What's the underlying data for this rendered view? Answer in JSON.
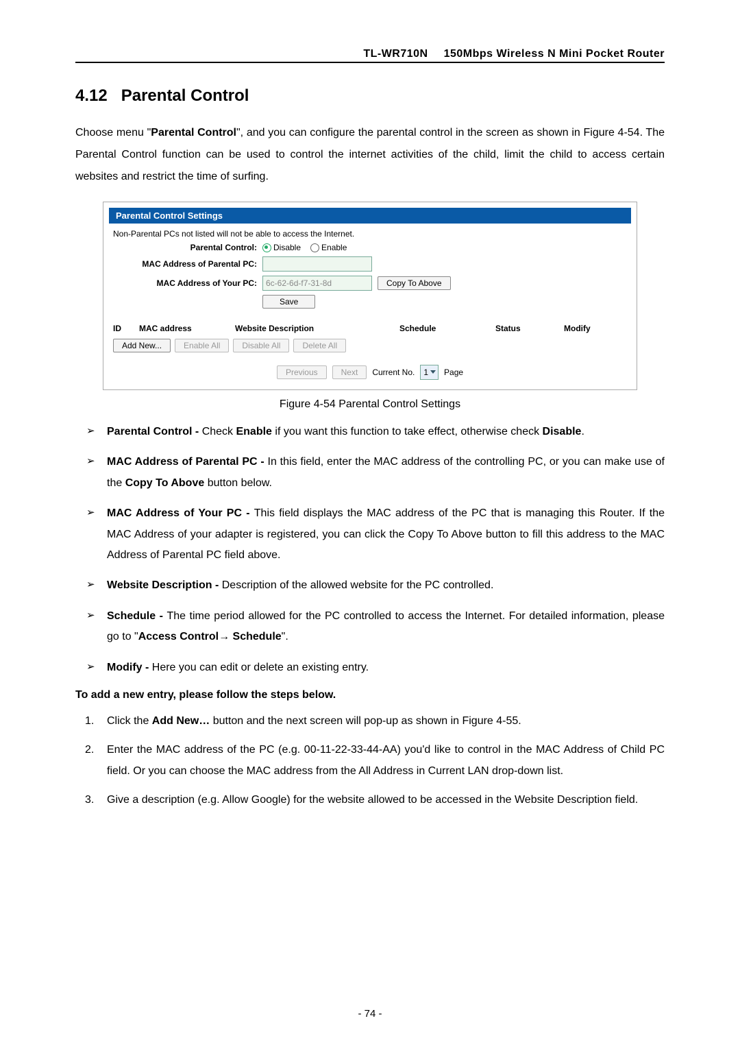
{
  "header": {
    "model": "TL-WR710N",
    "title": "150Mbps  Wireless  N  Mini  Pocket  Router"
  },
  "section": {
    "number": "4.12",
    "title": "Parental Control"
  },
  "intro": {
    "pre": "Choose menu \"",
    "menu": "Parental Control",
    "post": "\", and you can configure the parental control in the screen as shown in Figure 4-54. The Parental Control function can be used to control the internet activities of the child, limit the child to access certain websites and restrict the time of surfing."
  },
  "screenshot": {
    "panel_title": "Parental Control Settings",
    "note": "Non-Parental PCs not listed will not be able to access the Internet.",
    "labels": {
      "pc": "Parental Control:",
      "mac_parent": "MAC Address of Parental PC:",
      "mac_your": "MAC Address of Your PC:"
    },
    "radio": {
      "disable": "Disable",
      "enable": "Enable"
    },
    "mac_value": "6c-62-6d-f7-31-8d",
    "buttons": {
      "copy": "Copy To Above",
      "save": "Save",
      "addnew": "Add New...",
      "enableall": "Enable All",
      "disableall": "Disable All",
      "deleteall": "Delete All",
      "prev": "Previous",
      "next": "Next"
    },
    "cols": {
      "id": "ID",
      "mac": "MAC address",
      "desc": "Website Description",
      "sched": "Schedule",
      "status": "Status",
      "modify": "Modify"
    },
    "pager": {
      "current": "Current No.",
      "page": "Page",
      "sel": "1"
    }
  },
  "fig_caption": "Figure 4-54    Parental Control Settings",
  "bullets": [
    {
      "b1": "Parental Control - ",
      "t1": "Check ",
      "b2": "Enable",
      "t2": " if you want this function to take effect, otherwise check ",
      "b3": "Disable",
      "t3": "."
    },
    {
      "b1": "MAC Address of Parental PC - ",
      "t1": "In this field, enter the MAC address of the controlling PC, or you can make use of the ",
      "b2": "Copy To Above",
      "t2": " button below."
    },
    {
      "b1": "MAC Address of Your PC - ",
      "t1": "This field displays the MAC address of the PC that is managing this Router. If the MAC Address of your adapter is registered, you can click the Copy To Above button to fill this address to the MAC Address of Parental PC field above."
    },
    {
      "b1": "Website Description - ",
      "t1": "Description of the allowed website for the PC controlled."
    },
    {
      "b1": "Schedule - ",
      "t1": "The time period allowed for the PC controlled to access the Internet. For detailed information, please go to \"",
      "b2": "Access Control",
      "arrow": "→",
      "b3": " Schedule",
      "t2": "\"."
    },
    {
      "b1": "Modify - ",
      "t1": "Here you can edit or delete an existing entry."
    }
  ],
  "subhead": "To add a new entry, please follow the steps below.",
  "steps": [
    {
      "t1": "Click the ",
      "b1": "Add New…",
      "t2": " button and the next screen will pop-up as shown in Figure 4-55."
    },
    {
      "t1": "Enter the MAC address of the PC (e.g. 00-11-22-33-44-AA) you'd like to control in the MAC Address of Child PC field. Or you can choose the MAC address from the All Address in Current LAN drop-down list."
    },
    {
      "t1": "Give a description (e.g. Allow Google) for the website allowed to be accessed in the Website Description field."
    }
  ],
  "pagenum": "- 74 -"
}
